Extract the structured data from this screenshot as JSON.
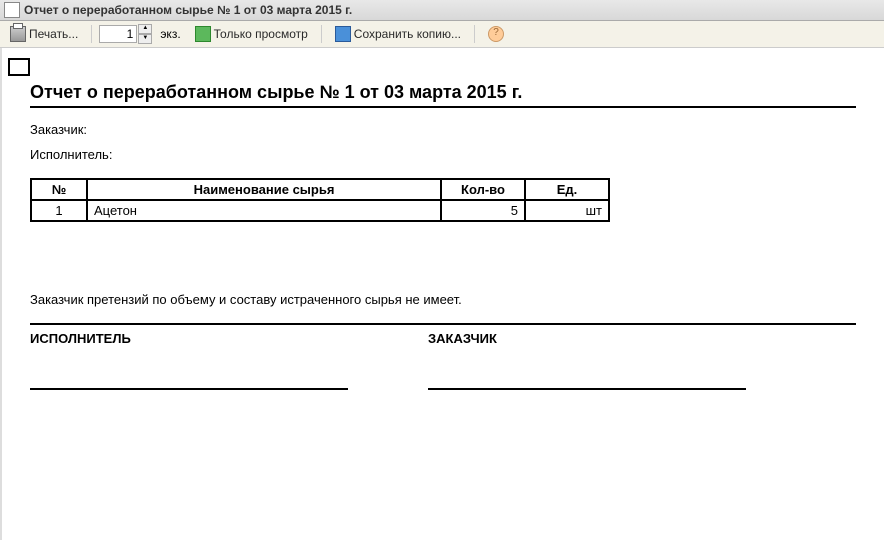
{
  "window": {
    "title": "Отчет о переработанном сырье  № 1 от 03 марта 2015 г."
  },
  "toolbar": {
    "print_label": "Печать...",
    "copies_value": "1",
    "copies_unit": "экз.",
    "view_only_label": "Только просмотр",
    "save_copy_label": "Сохранить копию...",
    "help_symbol": "?"
  },
  "document": {
    "title": "Отчет о переработанном сырье  № 1 от 03 марта 2015 г.",
    "customer_label": "Заказчик:",
    "executor_label": "Исполнитель:",
    "table": {
      "headers": {
        "no": "№",
        "name": "Наименование сырья",
        "qty": "Кол-во",
        "unit": "Ед."
      },
      "rows": [
        {
          "no": "1",
          "name": "Ацетон",
          "qty": "5",
          "unit": "шт"
        }
      ]
    },
    "claim_text": "Заказчик претензий по объему и составу истраченного сырья не имеет.",
    "sign_executor_label": "ИСПОЛНИТЕЛЬ",
    "sign_customer_label": "ЗАКАЗЧИК"
  }
}
